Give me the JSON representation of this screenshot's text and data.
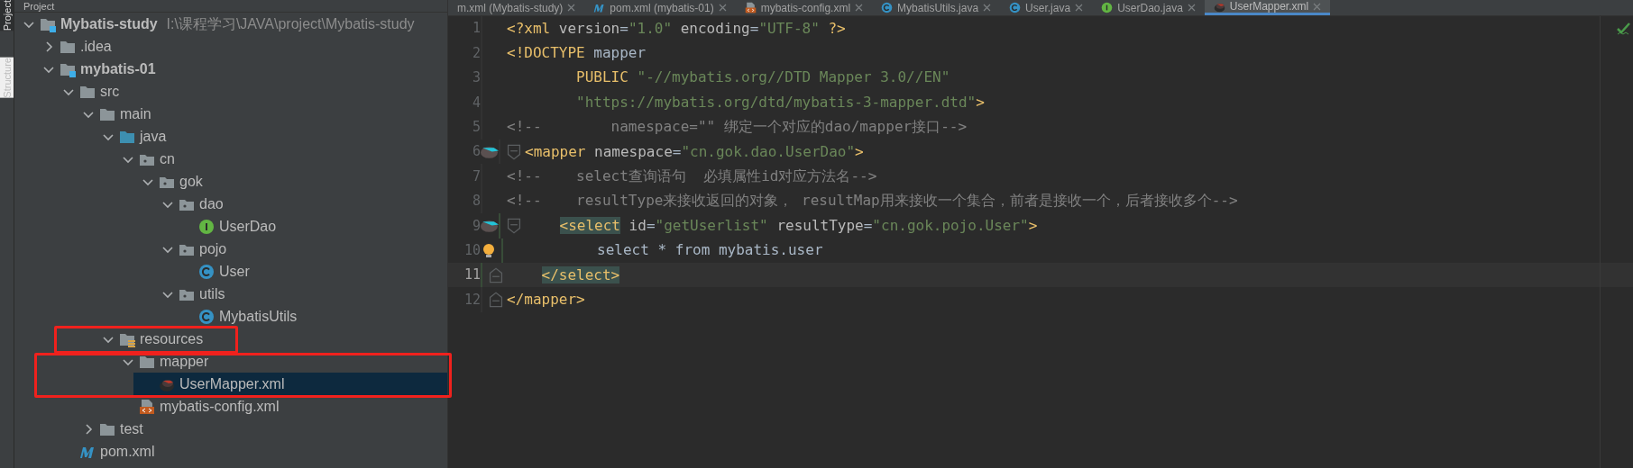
{
  "tool_strip": [
    {
      "label": "Project",
      "selected": true
    },
    {
      "label": "Structure",
      "selected": false
    }
  ],
  "project_panel": {
    "title": "Project",
    "tree": [
      {
        "label": "Mybatis-study",
        "path": "I:\\课程学习\\JAVA\\project\\Mybatis-study",
        "kind": "module",
        "bold": true,
        "expanded": true,
        "selected": false,
        "children": [
          {
            "label": ".idea",
            "kind": "folder",
            "bold": false,
            "expanded": false,
            "selected": false
          },
          {
            "label": "mybatis-01",
            "kind": "module",
            "bold": true,
            "expanded": true,
            "selected": false,
            "children": [
              {
                "label": "src",
                "kind": "folder",
                "bold": false,
                "expanded": true,
                "selected": false,
                "children": [
                  {
                    "label": "main",
                    "kind": "folder",
                    "bold": false,
                    "expanded": true,
                    "selected": false,
                    "children": [
                      {
                        "label": "java",
                        "kind": "source",
                        "bold": false,
                        "expanded": true,
                        "selected": false,
                        "children": [
                          {
                            "label": "cn",
                            "kind": "package",
                            "bold": false,
                            "expanded": true,
                            "selected": false,
                            "children": [
                              {
                                "label": "gok",
                                "kind": "package",
                                "bold": false,
                                "expanded": true,
                                "selected": false,
                                "children": [
                                  {
                                    "label": "dao",
                                    "kind": "package",
                                    "bold": false,
                                    "expanded": true,
                                    "selected": false,
                                    "children": [
                                      {
                                        "label": "UserDao",
                                        "kind": "interface",
                                        "bold": false,
                                        "selected": false
                                      }
                                    ]
                                  },
                                  {
                                    "label": "pojo",
                                    "kind": "package",
                                    "bold": false,
                                    "expanded": true,
                                    "selected": false,
                                    "children": [
                                      {
                                        "label": "User",
                                        "kind": "class",
                                        "bold": false,
                                        "selected": false
                                      }
                                    ]
                                  },
                                  {
                                    "label": "utils",
                                    "kind": "package",
                                    "bold": false,
                                    "expanded": true,
                                    "selected": false,
                                    "children": [
                                      {
                                        "label": "MybatisUtils",
                                        "kind": "class",
                                        "bold": false,
                                        "selected": false
                                      }
                                    ]
                                  }
                                ]
                              }
                            ]
                          }
                        ]
                      },
                      {
                        "label": "resources",
                        "kind": "resources",
                        "bold": false,
                        "expanded": true,
                        "selected": false,
                        "children": [
                          {
                            "label": "mapper",
                            "kind": "folder",
                            "bold": false,
                            "expanded": true,
                            "selected": false,
                            "children": [
                              {
                                "label": "UserMapper.xml",
                                "kind": "mybatis",
                                "bold": false,
                                "selected": true
                              }
                            ]
                          },
                          {
                            "label": "mybatis-config.xml",
                            "kind": "xml",
                            "bold": false,
                            "selected": false
                          }
                        ]
                      }
                    ]
                  },
                  {
                    "label": "test",
                    "kind": "folder",
                    "bold": false,
                    "expanded": false,
                    "selected": false
                  }
                ]
              },
              {
                "label": "pom.xml",
                "kind": "maven",
                "bold": false,
                "selected": false
              }
            ]
          }
        ]
      }
    ]
  },
  "callouts": [
    {
      "kind": "frame"
    },
    {
      "kind": "frame"
    }
  ],
  "editor_tabs": [
    {
      "label": "m.xml (Mybatis-study)",
      "kind": "plain",
      "selected": false
    },
    {
      "label": "pom.xml (mybatis-01)",
      "kind": "maven",
      "selected": false
    },
    {
      "label": "mybatis-config.xml",
      "kind": "xml",
      "selected": false
    },
    {
      "label": "MybatisUtils.java",
      "kind": "class",
      "selected": false
    },
    {
      "label": "User.java",
      "kind": "class",
      "selected": false
    },
    {
      "label": "UserDao.java",
      "kind": "interface",
      "selected": false
    },
    {
      "label": "UserMapper.xml",
      "kind": "mybatis",
      "selected": true
    }
  ],
  "editor": {
    "lines": [
      {
        "number": "1",
        "kind": "plain",
        "current": false,
        "changed": false,
        "tokens": [
          {
            "kind": "tag",
            "t": "<?xml"
          },
          {
            "kind": "attr",
            "t": " version"
          },
          {
            "kind": "text",
            "t": "="
          },
          {
            "kind": "val",
            "t": "\"1.0\""
          },
          {
            "kind": "attr",
            "t": " encoding"
          },
          {
            "kind": "text",
            "t": "="
          },
          {
            "kind": "val",
            "t": "\"UTF-8\""
          },
          {
            "kind": "tag",
            "t": " ?>"
          }
        ]
      },
      {
        "number": "2",
        "kind": "plain",
        "current": false,
        "changed": false,
        "tokens": [
          {
            "kind": "tag",
            "t": "<!DOCTYPE"
          },
          {
            "kind": "text",
            "t": " mapper"
          }
        ]
      },
      {
        "number": "3",
        "kind": "plain",
        "current": false,
        "changed": false,
        "tokens": [
          {
            "kind": "tag",
            "t": "        PUBLIC"
          },
          {
            "kind": "val",
            "t": " \"-//mybatis.org//DTD Mapper 3.0//EN\""
          }
        ]
      },
      {
        "number": "4",
        "kind": "plain",
        "current": false,
        "changed": false,
        "tokens": [
          {
            "kind": "val",
            "t": "        \"https://mybatis.org/dtd/mybatis-3-mapper.dtd\""
          },
          {
            "kind": "tag",
            "t": ">"
          }
        ]
      },
      {
        "number": "5",
        "kind": "plain",
        "current": false,
        "changed": false,
        "tokens": [
          {
            "kind": "comment",
            "t": "<!--        namespace=\"\" 绑定一个对应的dao/mapper接口-->"
          }
        ]
      },
      {
        "number": "6",
        "kind": "mapped",
        "current": false,
        "changed": false,
        "tokens": [
          {
            "kind": "tag",
            "t": "<mapper"
          },
          {
            "kind": "attr",
            "t": " namespace"
          },
          {
            "kind": "text",
            "t": "="
          },
          {
            "kind": "val",
            "t": "\"cn.gok.dao.UserDao\""
          },
          {
            "kind": "tag",
            "t": ">"
          }
        ]
      },
      {
        "number": "7",
        "kind": "plain",
        "current": false,
        "changed": false,
        "tokens": [
          {
            "kind": "comment",
            "t": "<!--    select查询语句  必填属性id对应方法名-->"
          }
        ]
      },
      {
        "number": "8",
        "kind": "plain",
        "current": false,
        "changed": false,
        "tokens": [
          {
            "kind": "comment",
            "t": "<!--    resultType来接收返回的对象， resultMap用来接收一个集合，前者是接收一个，后者接收多个-->"
          }
        ]
      },
      {
        "number": "9",
        "kind": "mapped",
        "current": false,
        "changed": true,
        "tokens": [
          {
            "kind": "tag",
            "t": "    <select",
            "matched": true
          },
          {
            "kind": "attr",
            "t": " id"
          },
          {
            "kind": "text",
            "t": "="
          },
          {
            "kind": "val",
            "t": "\"getUserlist\""
          },
          {
            "kind": "attr",
            "t": " resultType"
          },
          {
            "kind": "text",
            "t": "="
          },
          {
            "kind": "val",
            "t": "\"cn.gok.pojo.User\""
          },
          {
            "kind": "tag",
            "t": ">"
          }
        ]
      },
      {
        "number": "10",
        "kind": "hint",
        "current": false,
        "changed": true,
        "tokens": [
          {
            "kind": "text",
            "t": "        select * from mybatis.user"
          }
        ]
      },
      {
        "number": "11",
        "kind": "closing",
        "current": true,
        "changed": true,
        "tokens": [
          {
            "kind": "tag",
            "t": "    </select>",
            "matched": true
          }
        ]
      },
      {
        "number": "12",
        "kind": "closing",
        "current": false,
        "changed": false,
        "tokens": [
          {
            "kind": "tag",
            "t": "</mapper>"
          }
        ]
      }
    ]
  }
}
